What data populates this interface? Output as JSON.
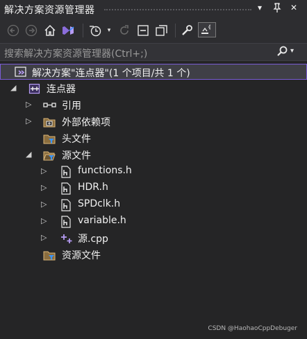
{
  "window": {
    "title": "解决方案资源管理器",
    "dropdown_glyph": "▾",
    "pin_glyph": "ᵖ",
    "close_glyph": "✕"
  },
  "toolbar": {
    "icons": [
      "back-icon",
      "forward-icon",
      "home-icon",
      "vs-switch-icon",
      "history-icon",
      "dropdown-icon",
      "refresh-icon",
      "collapse-all-icon",
      "show-all-files-icon",
      "properties-wrench-icon",
      "preview-selected-icon"
    ]
  },
  "search": {
    "placeholder": "搜索解决方案资源管理器(Ctrl+;)",
    "icon": "search-icon"
  },
  "tree": {
    "solution_label": "解决方案\"连点器\"(1 个项目/共 1 个)",
    "project_label": "连点器",
    "items": {
      "references": "引用",
      "external": "外部依赖项",
      "headers": "头文件",
      "sources": "源文件",
      "resources": "资源文件"
    },
    "source_children": [
      "functions.h",
      "HDR.h",
      "SPDclk.h",
      "variable.h",
      "源.cpp"
    ]
  },
  "watermark": "CSDN @HaohaoCppDebuger",
  "colors": {
    "accent": "#7a5cd6",
    "background": "#252526",
    "folder": "#dcb67a",
    "filter_blue": "#3794ff"
  }
}
